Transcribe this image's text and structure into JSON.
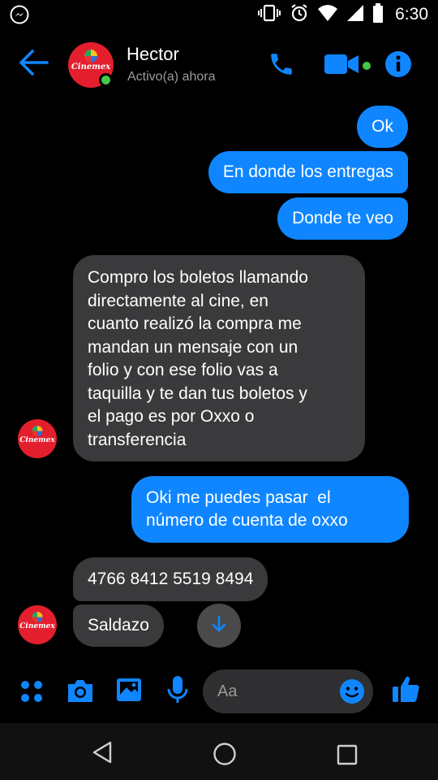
{
  "status_bar": {
    "time": "6:30",
    "icons": [
      "messenger-icon",
      "vibrate-icon",
      "alarm-icon",
      "wifi-icon",
      "signal-icon",
      "battery-icon"
    ]
  },
  "header": {
    "contact_name": "Hector",
    "status": "Activo(a) ahora",
    "avatar_text": "Cinemex",
    "online": true,
    "icons": [
      "back-arrow-icon",
      "phone-icon",
      "video-camera-icon",
      "info-icon"
    ]
  },
  "messages": [
    {
      "side": "outgoing",
      "text": "Ok"
    },
    {
      "side": "outgoing",
      "text": "En donde los entregas"
    },
    {
      "side": "outgoing",
      "text": "Donde te veo"
    },
    {
      "side": "incoming",
      "lines": [
        "Compro los boletos llamando",
        "directamente al cine, en",
        "cuanto realizó la compra me",
        "mandan un mensaje con un",
        "folio y con ese folio vas a",
        "taquilla y te dan tus boletos y",
        "el pago es por Oxxo o",
        "transferencia"
      ]
    },
    {
      "side": "outgoing",
      "lines": [
        "Oki me puedes pasar  el",
        "número de cuenta de oxxo"
      ]
    },
    {
      "side": "incoming",
      "text": "4766 8412 5519 8494"
    },
    {
      "side": "incoming",
      "text": "Saldazo"
    }
  ],
  "composer": {
    "placeholder": "Aa",
    "icons": [
      "apps-grid-icon",
      "camera-icon",
      "image-icon",
      "microphone-icon",
      "emoji-icon",
      "thumbs-up-icon"
    ]
  },
  "nav": {
    "icons": [
      "back-triangle-icon",
      "home-circle-icon",
      "recents-square-icon"
    ]
  },
  "colors": {
    "accent": "#0f86ff",
    "incoming_bubble": "#3a3a3c",
    "online": "#44c847",
    "avatar_red": "#e41f2d"
  }
}
